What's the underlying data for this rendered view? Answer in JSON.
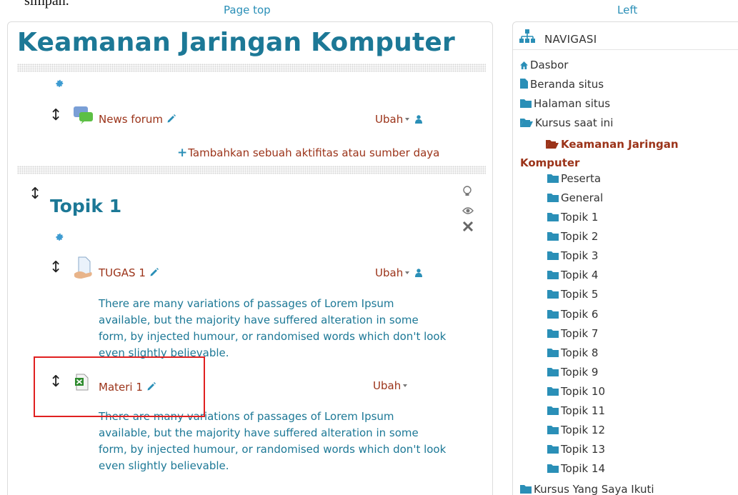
{
  "top_clip_text": "simpan.",
  "labels": {
    "page_top": "Page top",
    "left": "Left"
  },
  "course": {
    "title": "Keamanan Jaringan Komputer",
    "general_section": {
      "activity": {
        "name": "News forum",
        "edit_menu": "Ubah"
      },
      "add_activity": "Tambahkan sebuah aktifitas atau sumber daya"
    },
    "topic1": {
      "title": "Topik 1",
      "activities": [
        {
          "name": "TUGAS 1",
          "edit_menu": "Ubah",
          "description": "There are many variations of passages of Lorem Ipsum available, but the majority have suffered alteration in some form, by injected humour, or randomised words which don't look even slightly believable."
        },
        {
          "name": "Materi 1",
          "edit_menu": "Ubah",
          "description": "There are many variations of passages of Lorem Ipsum available, but the majority have suffered alteration in some form, by injected humour, or randomised words which don't look even slightly believable."
        }
      ]
    }
  },
  "navigation": {
    "title": "NAVIGASI",
    "items": [
      {
        "label": "Dasbor",
        "icon": "home-icon"
      },
      {
        "label": "Beranda situs",
        "icon": "file-icon"
      },
      {
        "label": "Halaman situs",
        "icon": "folder-icon"
      },
      {
        "label": "Kursus saat ini",
        "icon": "folder-open-icon"
      },
      {
        "label": "Keamanan Jaringan Komputer",
        "icon": "folder-open-icon"
      },
      {
        "label": "Peserta",
        "icon": "folder-icon"
      },
      {
        "label": "General",
        "icon": "folder-icon"
      },
      {
        "label": "Topik 1",
        "icon": "folder-icon"
      },
      {
        "label": "Topik 2",
        "icon": "folder-icon"
      },
      {
        "label": "Topik 3",
        "icon": "folder-icon"
      },
      {
        "label": "Topik 4",
        "icon": "folder-icon"
      },
      {
        "label": "Topik 5",
        "icon": "folder-icon"
      },
      {
        "label": "Topik 6",
        "icon": "folder-icon"
      },
      {
        "label": "Topik 7",
        "icon": "folder-icon"
      },
      {
        "label": "Topik 8",
        "icon": "folder-icon"
      },
      {
        "label": "Topik 9",
        "icon": "folder-icon"
      },
      {
        "label": "Topik 10",
        "icon": "folder-icon"
      },
      {
        "label": "Topik 11",
        "icon": "folder-icon"
      },
      {
        "label": "Topik 12",
        "icon": "folder-icon"
      },
      {
        "label": "Topik 13",
        "icon": "folder-icon"
      },
      {
        "label": "Topik 14",
        "icon": "folder-icon"
      },
      {
        "label": "Kursus Yang Saya Ikuti",
        "icon": "folder-icon"
      }
    ]
  },
  "colors": {
    "accent": "#1c7896",
    "link": "#9b3319",
    "highlight": "#e02020"
  }
}
